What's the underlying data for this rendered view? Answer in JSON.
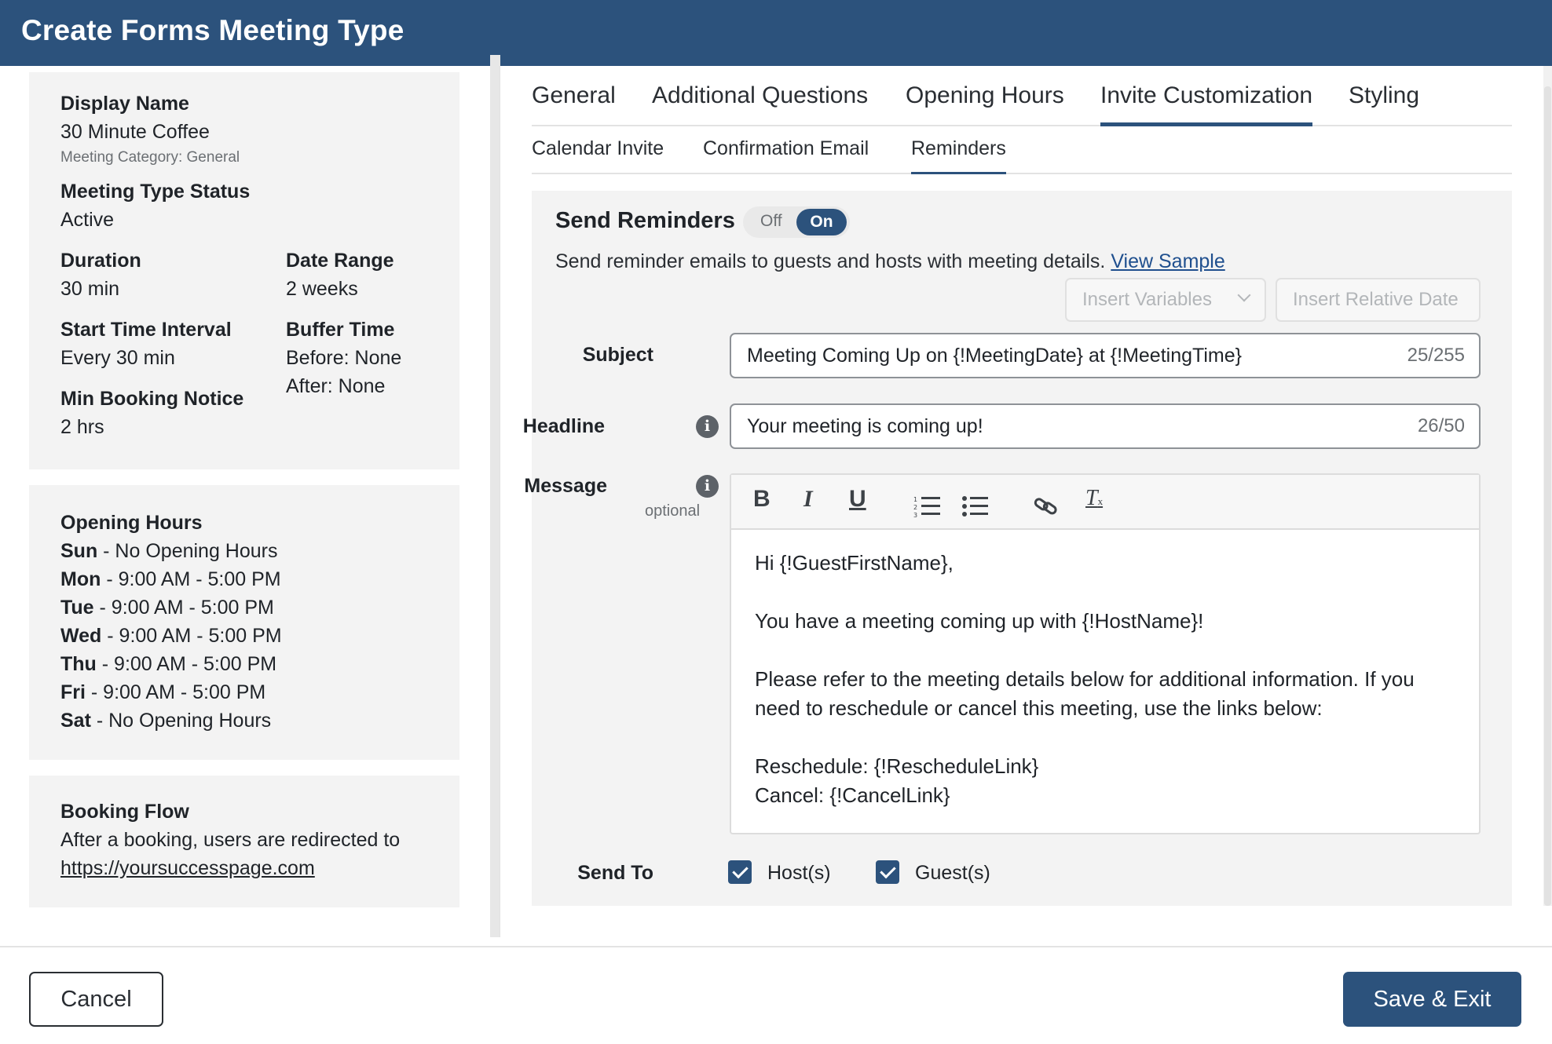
{
  "window": {
    "title": "Create Forms Meeting Type"
  },
  "summary": {
    "display_name_label": "Display Name",
    "display_name": "30 Minute Coffee",
    "meeting_category": "Meeting Category: General",
    "status_label": "Meeting Type Status",
    "status": "Active",
    "duration_label": "Duration",
    "duration": "30 min",
    "date_range_label": "Date Range",
    "date_range": "2 weeks",
    "start_interval_label": "Start Time Interval",
    "start_interval": "Every 30 min",
    "buffer_label": "Buffer Time",
    "buffer_before": "Before: None",
    "buffer_after": "After: None",
    "min_notice_label": "Min Booking Notice",
    "min_notice": "2 hrs"
  },
  "opening_hours": {
    "title": "Opening Hours",
    "days": [
      {
        "day": "Sun",
        "hours": " - No Opening Hours"
      },
      {
        "day": "Mon",
        "hours": " - 9:00 AM - 5:00 PM"
      },
      {
        "day": "Tue",
        "hours": " - 9:00 AM - 5:00 PM"
      },
      {
        "day": "Wed",
        "hours": " - 9:00 AM - 5:00 PM"
      },
      {
        "day": "Thu",
        "hours": " - 9:00 AM - 5:00 PM"
      },
      {
        "day": "Fri",
        "hours": " - 9:00 AM - 5:00 PM"
      },
      {
        "day": "Sat",
        "hours": " - No Opening Hours"
      }
    ]
  },
  "booking_flow": {
    "title": "Booking Flow",
    "text": "After a booking, users are redirected to",
    "url": "https://yoursuccesspage.com"
  },
  "tabs": [
    {
      "label": "General",
      "active": false
    },
    {
      "label": "Additional Questions",
      "active": false
    },
    {
      "label": "Opening Hours",
      "active": false
    },
    {
      "label": "Invite Customization",
      "active": true
    },
    {
      "label": "Styling",
      "active": false
    }
  ],
  "subtabs": [
    {
      "label": "Calendar Invite",
      "active": false
    },
    {
      "label": "Confirmation Email",
      "active": false
    },
    {
      "label": "Reminders",
      "active": true
    }
  ],
  "reminders": {
    "title": "Send Reminders",
    "toggle_off": "Off",
    "toggle_on": "On",
    "toggle_value": "On",
    "description": "Send reminder emails to guests and hosts with meeting details. ",
    "view_sample": "View Sample",
    "insert_variables": "Insert Variables",
    "insert_relative_date": "Insert Relative Date",
    "subject_label": "Subject",
    "subject_value": "Meeting Coming Up on {!MeetingDate} at {!MeetingTime}",
    "subject_count": "25/255",
    "headline_label": "Headline",
    "headline_value": "Your meeting is coming up!",
    "headline_count": "26/50",
    "message_label": "Message",
    "message_optional": "optional",
    "toolbar": {
      "bold": "B",
      "italic": "I",
      "underline": "U",
      "clear_format": "T"
    },
    "message_lines": [
      "Hi {!GuestFirstName},",
      "",
      "You have a meeting coming up with {!HostName}!",
      "",
      "Please refer to the meeting details below for additional information. If you need to reschedule or cancel this meeting, use the links below:",
      "",
      "Reschedule: {!RescheduleLink}",
      "Cancel: {!CancelLink}"
    ],
    "send_to_label": "Send To",
    "host_label": "Host(s)",
    "host_checked": true,
    "guest_label": "Guest(s)",
    "guest_checked": true
  },
  "footer": {
    "cancel": "Cancel",
    "save": "Save & Exit"
  },
  "info_icon_glyph": "i",
  "colors": {
    "header": "#2c527c",
    "accent": "#2c527c",
    "panel": "#f3f3f3"
  }
}
